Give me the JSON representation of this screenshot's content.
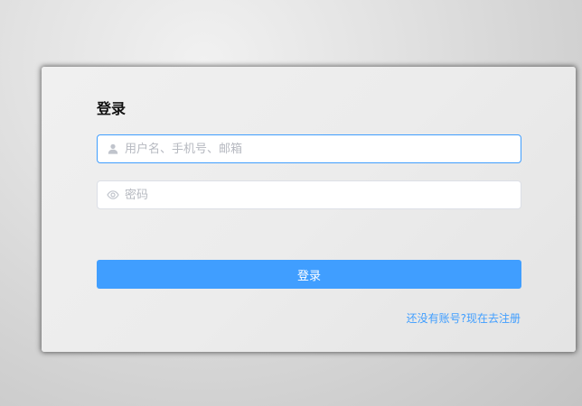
{
  "login_form": {
    "title": "登录",
    "username": {
      "value": "",
      "placeholder": "用户名、手机号、邮箱",
      "icon": "user-icon"
    },
    "password": {
      "value": "",
      "placeholder": "密码",
      "icon": "eye-icon"
    },
    "submit_label": "登录",
    "register_link": "还没有账号?现在去注册"
  },
  "colors": {
    "accent": "#409eff",
    "focus_border": "#409eff",
    "placeholder": "#b6b9c0",
    "icon": "#c0c4cc"
  }
}
